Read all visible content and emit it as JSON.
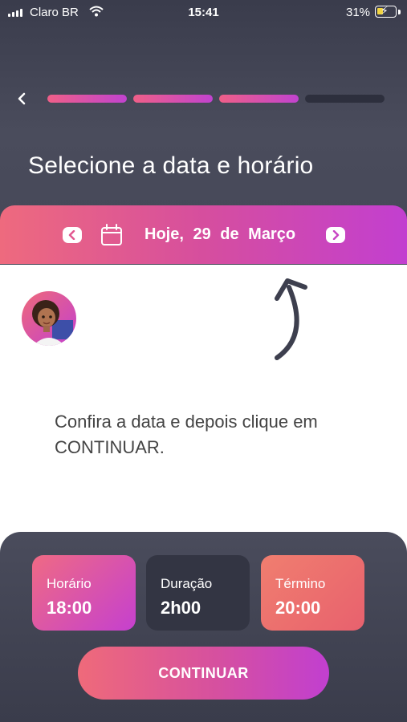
{
  "status_bar": {
    "carrier": "Claro BR",
    "time": "15:41",
    "battery": "31%"
  },
  "header": {
    "title": "Selecione a data e horário",
    "progress_steps": 4,
    "progress_completed": 3
  },
  "date_selector": {
    "date_text": "Hoje, 29 de Março"
  },
  "instruction": {
    "text": "Confira a data e depois clique em CONTINUAR."
  },
  "summary": {
    "start": {
      "label": "Horário",
      "value": "18:00"
    },
    "duration": {
      "label": "Duração",
      "value": "2h00"
    },
    "end": {
      "label": "Término",
      "value": "20:00"
    }
  },
  "cta": {
    "label": "CONTINUAR"
  },
  "colors": {
    "accent_start": "#ef6a7a",
    "accent_end": "#c13fd0",
    "dark": "#3a3c4c"
  }
}
